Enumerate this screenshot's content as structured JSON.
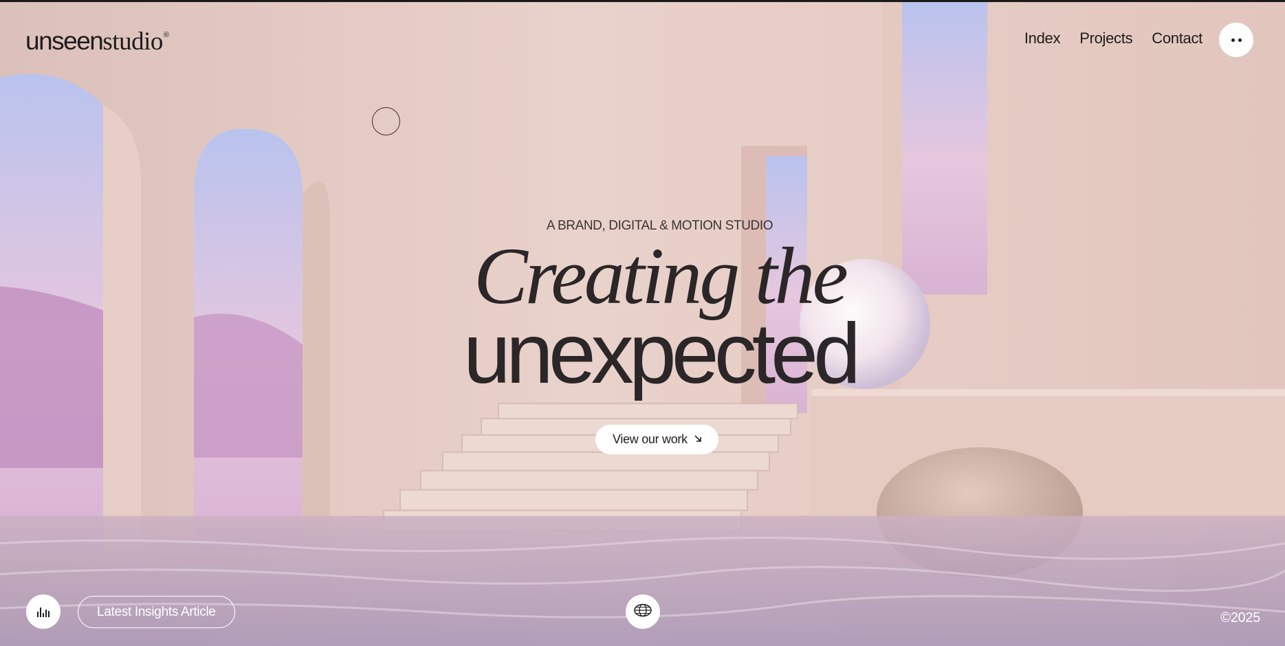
{
  "header": {
    "logo_main": "unseen",
    "logo_secondary": "studio",
    "logo_mark": "®",
    "nav": [
      "Index",
      "Projects",
      "Contact"
    ],
    "menu_icon": "dots-menu-icon"
  },
  "hero": {
    "eyebrow": "A BRAND, DIGITAL & MOTION STUDIO",
    "headline_line1": "Creating the",
    "headline_line2": "unexpected",
    "cta_label": "View our work",
    "cta_icon": "arrow-down-right-icon"
  },
  "footer": {
    "sound_icon": "sound-bars-icon",
    "insights_label": "Latest Insights Article",
    "globe_icon": "globe-icon",
    "copyright": "©2025"
  },
  "colors": {
    "text_dark": "#1d1d1d",
    "headline": "#2b2627",
    "wall_pink": "#e8cfc7",
    "button_bg": "#ffffff"
  }
}
